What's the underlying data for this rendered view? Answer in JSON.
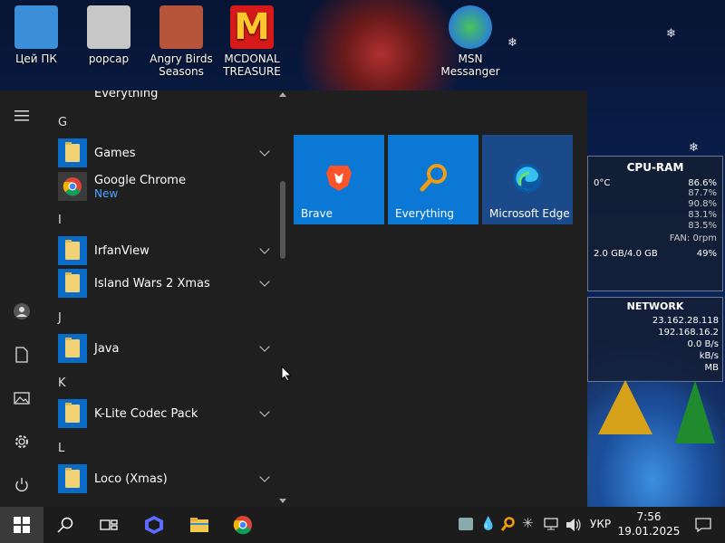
{
  "desktop": {
    "icons": [
      {
        "label": "Цей ПК"
      },
      {
        "label": "popcap"
      },
      {
        "label": "Angry Birds Seasons"
      },
      {
        "label": "MCDONAL TREASURE"
      },
      {
        "label": "MSN Messanger"
      }
    ]
  },
  "start_menu": {
    "apps": [
      {
        "label": "Everything"
      },
      {
        "letter": "G"
      },
      {
        "label": "Games",
        "expandable": true
      },
      {
        "label": "Google Chrome",
        "sub": "New"
      },
      {
        "letter": "I"
      },
      {
        "label": "IrfanView",
        "expandable": true
      },
      {
        "label": "Island Wars 2 Xmas",
        "expandable": true
      },
      {
        "letter": "J"
      },
      {
        "label": "Java",
        "expandable": true
      },
      {
        "letter": "K"
      },
      {
        "label": "K-Lite Codec Pack",
        "expandable": true
      },
      {
        "letter": "L"
      },
      {
        "label": "Loco (Xmas)",
        "expandable": true
      }
    ],
    "tiles": [
      {
        "label": "Brave",
        "color": "#0a78d4"
      },
      {
        "label": "Everything",
        "color": "#0a78d4"
      },
      {
        "label": "Microsoft Edge",
        "color": "#1a4a8a"
      }
    ]
  },
  "widget": {
    "title": "CPU-RAM",
    "temp": "0°C",
    "cpu_total": "86.6%",
    "cores": [
      "87.7%",
      "90.8%",
      "83.1%",
      "83.5%"
    ],
    "fan": "FAN: 0rpm",
    "ram": "2.0 GB/4.0 GB",
    "ram_pct": "49%",
    "net_title": "NETWORK",
    "ip1": "23.162.28.118",
    "ip2": "192.168.16.2",
    "rate": "0.0 B/s",
    "rate2": "kB/s",
    "mb": "MB"
  },
  "taskbar": {
    "lang": "УКР",
    "time": "7:56",
    "date": "19.01.2025"
  }
}
